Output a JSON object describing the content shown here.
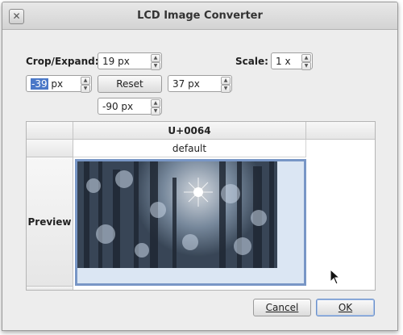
{
  "window": {
    "title": "LCD Image Converter",
    "close_glyph": "✕"
  },
  "crop": {
    "label": "Crop/Expand:",
    "top_value": "19 px",
    "left_value_selected": "-39",
    "left_value_unit": " px",
    "reset_label": "Reset",
    "right_value": "37 px",
    "bottom_value": "-90 px"
  },
  "scale": {
    "label": "Scale:",
    "value": "1 x"
  },
  "grid": {
    "column_header": "U+0064",
    "row_default": "default",
    "row_preview": "Preview"
  },
  "buttons": {
    "cancel": "Cancel",
    "ok": "OK"
  },
  "icons": {
    "spin_up": "▲",
    "spin_down": "▼",
    "cursor": "mouse-pointer-icon"
  },
  "colors": {
    "selection": "#4a78c8",
    "preview_border": "#7896c6",
    "preview_bg": "#dbe6f3"
  }
}
